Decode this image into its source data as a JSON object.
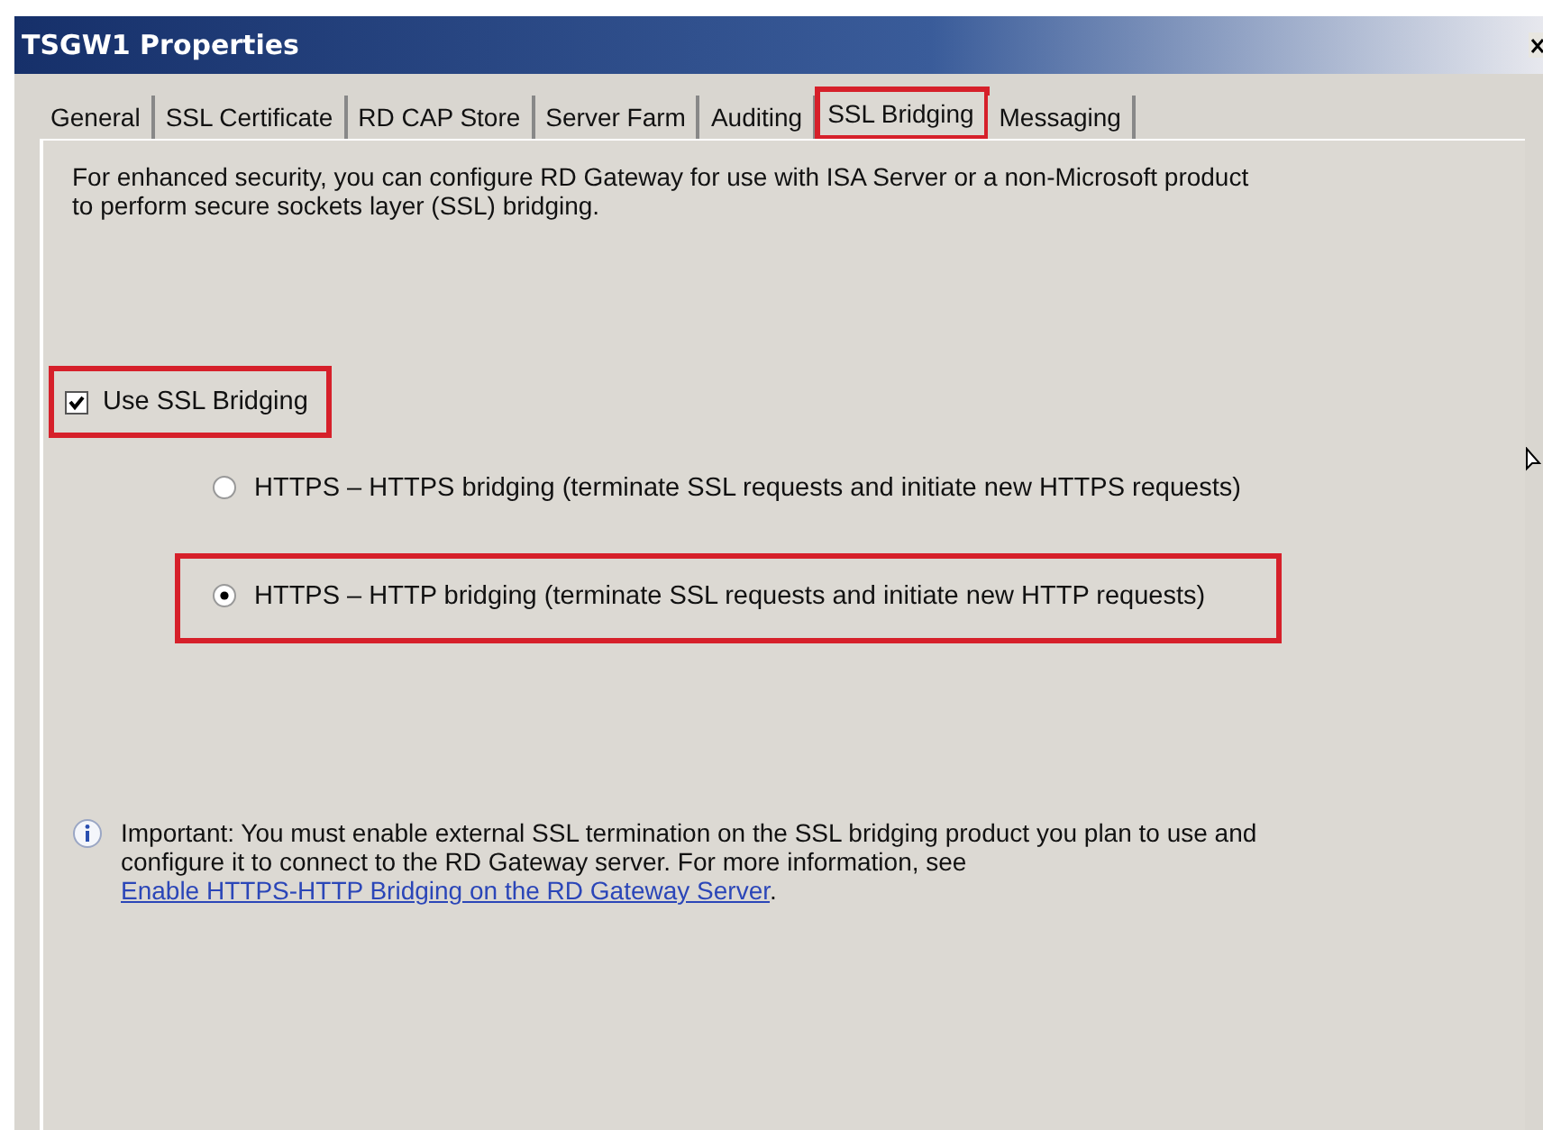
{
  "window": {
    "title": "TSGW1 Properties"
  },
  "tabs": [
    {
      "label": "General",
      "selected": false,
      "highlighted": false
    },
    {
      "label": "SSL Certificate",
      "selected": false,
      "highlighted": false
    },
    {
      "label": "RD CAP Store",
      "selected": false,
      "highlighted": false
    },
    {
      "label": "Server Farm",
      "selected": false,
      "highlighted": false
    },
    {
      "label": "Auditing",
      "selected": false,
      "highlighted": false
    },
    {
      "label": "SSL Bridging",
      "selected": true,
      "highlighted": true
    },
    {
      "label": "Messaging",
      "selected": false,
      "highlighted": false
    }
  ],
  "description": "For enhanced security, you can configure RD Gateway for use with ISA Server or a non-Microsoft product to perform secure sockets layer (SSL) bridging.",
  "use_ssl_bridging": {
    "label": "Use SSL Bridging",
    "checked": true,
    "highlighted": true
  },
  "options": [
    {
      "label": "HTTPS – HTTPS bridging (terminate SSL requests and initiate new HTTPS requests)",
      "selected": false,
      "highlighted": false
    },
    {
      "label": "HTTPS – HTTP bridging (terminate SSL requests and initiate new HTTP requests)",
      "selected": true,
      "highlighted": true
    }
  ],
  "info": {
    "text": "Important: You must enable external SSL termination on the SSL bridging product you plan to use and configure it to connect to the RD Gateway server. For more information, see",
    "link": "Enable HTTPS-HTTP Bridging on the RD Gateway Server",
    "suffix": "."
  }
}
